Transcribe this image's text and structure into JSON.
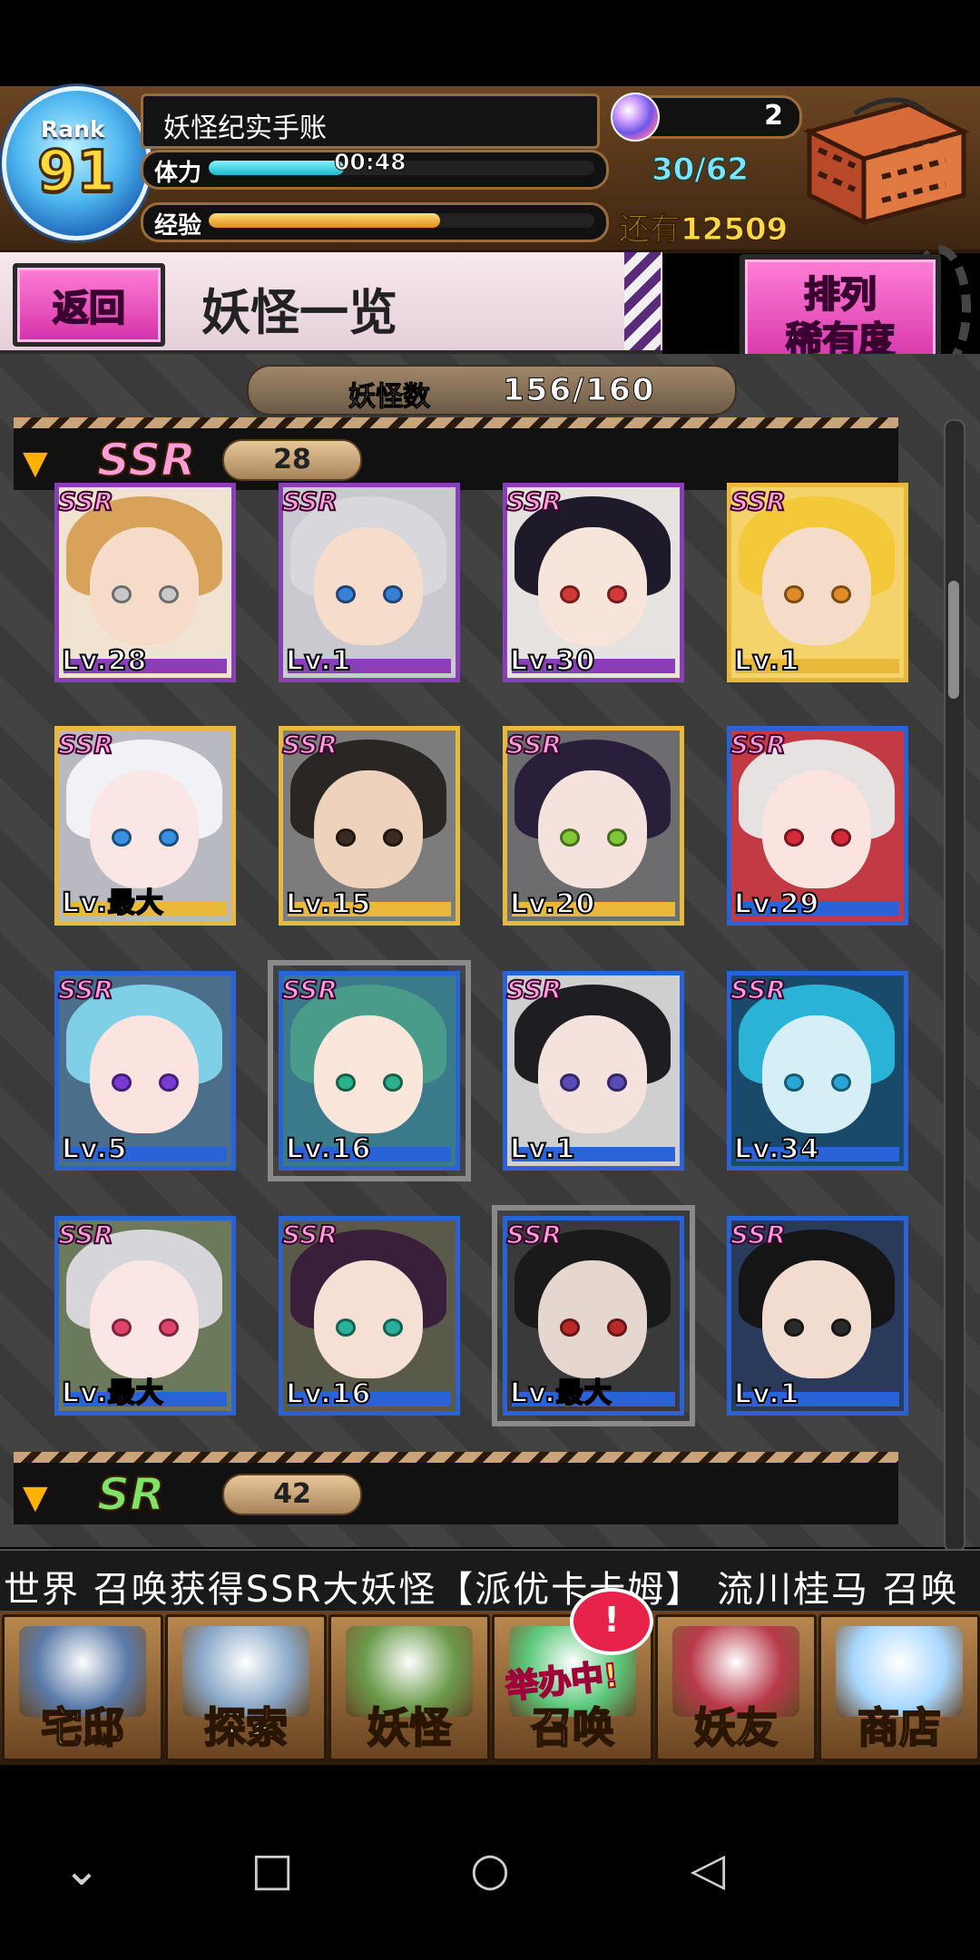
{
  "header": {
    "rank_word": "Rank",
    "rank_level": "91",
    "player_name": "妖怪纪实手账",
    "stamina_label": "体力",
    "stamina_timer": "00:48",
    "stamina_value": "30/62",
    "stamina_fill": 0.35,
    "exp_label": "经验",
    "exp_fill": 0.6,
    "exp_remaining": "还有12509",
    "gem_count": "2"
  },
  "title": {
    "back_label": "返回",
    "page_title": "妖怪一览",
    "sort_line1": "排列",
    "sort_line2": "稀有度"
  },
  "collection": {
    "label": "妖怪数",
    "value": "156/160"
  },
  "sections": [
    {
      "rarity": "SSR",
      "count": "28"
    },
    {
      "rarity": "SR",
      "count": "42"
    }
  ],
  "cards": [
    {
      "badge": "SSR",
      "level": "Lv.28",
      "frame": "#8a3fb8",
      "hair": "#d9a25a",
      "skin": "#f6dcc8",
      "eye": "#c9c9c9",
      "bg": "#f1e3d2"
    },
    {
      "badge": "SSR",
      "level": "Lv.1",
      "frame": "#8a3fb8",
      "hair": "#d7d7dc",
      "skin": "#f5dccb",
      "eye": "#3a7fd6",
      "bg": "#c9c9cf"
    },
    {
      "badge": "SSR",
      "level": "Lv.30",
      "frame": "#8a3fb8",
      "hair": "#1f1a2a",
      "skin": "#f7e4da",
      "eye": "#d23a3a",
      "bg": "#e6e2e0"
    },
    {
      "badge": "SSR",
      "level": "Lv.1",
      "frame": "#e8b93a",
      "hair": "#f3c93a",
      "skin": "#f5dcc8",
      "eye": "#e08a2a",
      "bg": "#f3d36a"
    },
    {
      "badge": "SSR",
      "level": "Lv.最大",
      "frame": "#e8b93a",
      "hair": "#f2f2f6",
      "skin": "#fbe6e6",
      "eye": "#3a8fe0",
      "bg": "#b9b9c2"
    },
    {
      "badge": "SSR",
      "level": "Lv.15",
      "frame": "#e8b93a",
      "hair": "#2a2624",
      "skin": "#efd2bb",
      "eye": "#3a2a22",
      "bg": "#7c7c7c"
    },
    {
      "badge": "SSR",
      "level": "Lv.20",
      "frame": "#e8b93a",
      "hair": "#2a1f3a",
      "skin": "#f6e2dc",
      "eye": "#7ec83a",
      "bg": "#6d6d70"
    },
    {
      "badge": "SSR",
      "level": "Lv.29",
      "frame": "#2a62d8",
      "hair": "#e6e2e2",
      "skin": "#fbe3e0",
      "eye": "#d42a3a",
      "bg": "#c23a44"
    },
    {
      "badge": "SSR",
      "level": "Lv.5",
      "frame": "#2a62d8",
      "hair": "#7fd0e6",
      "skin": "#fbe3e0",
      "eye": "#7a3ad4",
      "bg": "#4b6e8a"
    },
    {
      "badge": "SSR",
      "level": "Lv.16",
      "frame": "#2a62d8",
      "hair": "#4a9c8a",
      "skin": "#fbe6dc",
      "eye": "#2ab08a",
      "bg": "#3a7a8a"
    },
    {
      "badge": "SSR",
      "level": "Lv.1",
      "frame": "#2a62d8",
      "hair": "#1e1e22",
      "skin": "#f6e2dc",
      "eye": "#5a4ab8",
      "bg": "#cfcfcf"
    },
    {
      "badge": "SSR",
      "level": "Lv.34",
      "frame": "#2a62d8",
      "hair": "#2ab3d6",
      "skin": "#d6eef6",
      "eye": "#2aa6d6",
      "bg": "#1a4a6a"
    },
    {
      "badge": "SSR",
      "level": "Lv.最大",
      "frame": "#2a62d8",
      "hair": "#d6d6da",
      "skin": "#fbe6e6",
      "eye": "#e0446a",
      "bg": "#6a7a5a"
    },
    {
      "badge": "SSR",
      "level": "Lv.16",
      "frame": "#2a62d8",
      "hair": "#3a1f3a",
      "skin": "#f6e0d6",
      "eye": "#2ab09a",
      "bg": "#5a5a4a"
    },
    {
      "badge": "SSR",
      "level": "Lv.最大",
      "frame": "#2a62d8",
      "hair": "#1a1a1a",
      "skin": "#e6d6d0",
      "eye": "#b82a2a",
      "bg": "#3a3a3a"
    },
    {
      "badge": "SSR",
      "level": "Lv.1",
      "frame": "#2a62d8",
      "hair": "#151515",
      "skin": "#f2dccf",
      "eye": "#2a2a2a",
      "bg": "#2a3a5a"
    }
  ],
  "selected_cards": [
    9,
    14
  ],
  "ticker": "世界 召唤获得SSR大妖怪【派优卡卡姆】     流川桂马 召唤",
  "nav": [
    {
      "label": "宅邸",
      "icon": "mansion-icon",
      "color": "#5a7aa8"
    },
    {
      "label": "探索",
      "icon": "magnifier-map-icon",
      "color": "#8aa8c8"
    },
    {
      "label": "妖怪",
      "icon": "scroll-icon",
      "color": "#6a9a4a"
    },
    {
      "label": "召唤",
      "icon": "summon-icon",
      "color": "#5ac87a",
      "event": "举办中!"
    },
    {
      "label": "妖友",
      "icon": "fox-girl-icon",
      "color": "#b83a4a"
    },
    {
      "label": "商店",
      "icon": "crystal-orb-icon",
      "color": "#a8d8ff"
    }
  ],
  "alert_badge": "!",
  "system_nav": {
    "back_icon": "◁",
    "home_icon": "○",
    "recents_icon": "□",
    "down_icon": "⌄"
  }
}
